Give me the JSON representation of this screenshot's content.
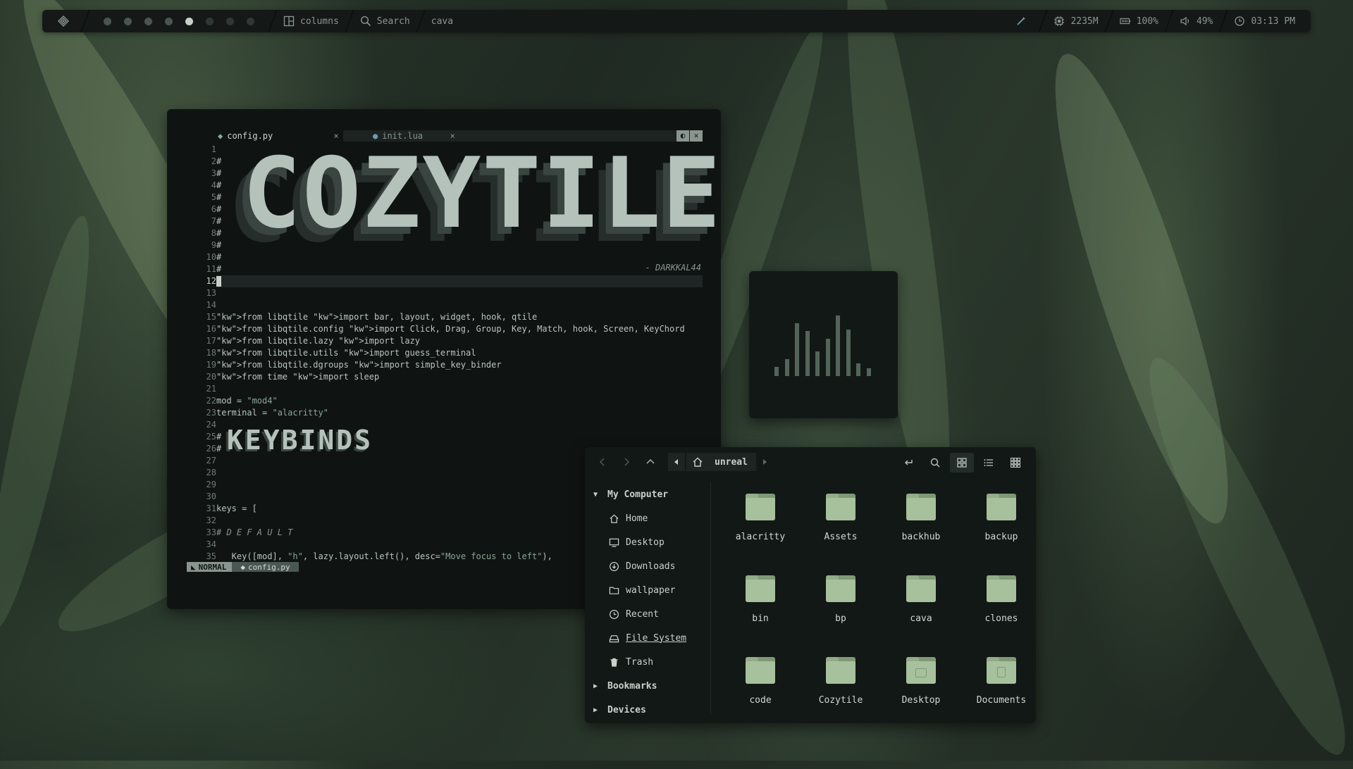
{
  "topbar": {
    "layout_label": "columns",
    "search_label": "Search",
    "window_title": "cava",
    "memory": "2235M",
    "battery": "100%",
    "volume": "49%",
    "clock": "03:13 PM",
    "workspaces": [
      "ws1",
      "ws2",
      "ws3",
      "ws4",
      "ws5",
      "ws6",
      "ws7",
      "ws8"
    ],
    "active_workspace": 5
  },
  "editor": {
    "tabs": [
      {
        "label": "config.py",
        "close": "×"
      },
      {
        "label": "init.lua",
        "close": "×"
      }
    ],
    "banner": "COZYTILE",
    "author": "- DARKKAL44",
    "section_banner": "KEYBINDS",
    "statusline": {
      "mode": "NORMAL",
      "file": "config.py"
    },
    "lines": [
      {
        "n": "1",
        "code": ""
      },
      {
        "n": "2",
        "code": "#"
      },
      {
        "n": "3",
        "code": "#"
      },
      {
        "n": "4",
        "code": "#"
      },
      {
        "n": "5",
        "code": "#"
      },
      {
        "n": "6",
        "code": "#"
      },
      {
        "n": "7",
        "code": "#"
      },
      {
        "n": "8",
        "code": "#"
      },
      {
        "n": "9",
        "code": "#"
      },
      {
        "n": "10",
        "code": "#"
      },
      {
        "n": "11",
        "code": "#"
      },
      {
        "n": "12",
        "code": ""
      },
      {
        "n": "13",
        "code": ""
      },
      {
        "n": "14",
        "code": ""
      },
      {
        "n": "15",
        "code": "from libqtile import bar, layout, widget, hook, qtile"
      },
      {
        "n": "16",
        "code": "from libqtile.config import Click, Drag, Group, Key, Match, hook, Screen, KeyChord"
      },
      {
        "n": "17",
        "code": "from libqtile.lazy import lazy"
      },
      {
        "n": "18",
        "code": "from libqtile.utils import guess_terminal"
      },
      {
        "n": "19",
        "code": "from libqtile.dgroups import simple_key_binder"
      },
      {
        "n": "20",
        "code": "from time import sleep"
      },
      {
        "n": "21",
        "code": ""
      },
      {
        "n": "22",
        "code": "mod = \"mod4\""
      },
      {
        "n": "23",
        "code": "terminal = \"alacritty\""
      },
      {
        "n": "24",
        "code": ""
      },
      {
        "n": "25",
        "code": "#"
      },
      {
        "n": "26",
        "code": "#"
      },
      {
        "n": "27",
        "code": ""
      },
      {
        "n": "28",
        "code": ""
      },
      {
        "n": "29",
        "code": ""
      },
      {
        "n": "30",
        "code": ""
      },
      {
        "n": "31",
        "code": "keys = ["
      },
      {
        "n": "32",
        "code": ""
      },
      {
        "n": "33",
        "code": "# D E F A U L T"
      },
      {
        "n": "34",
        "code": ""
      },
      {
        "n": "35",
        "code": "   Key([mod], \"h\", lazy.layout.left(), desc=\"Move focus to left\"),"
      }
    ]
  },
  "visualizer": {
    "levels": [
      0.12,
      0.22,
      0.68,
      0.58,
      0.32,
      0.48,
      0.78,
      0.6,
      0.16,
      0.1
    ]
  },
  "filemanager": {
    "location": "unreal",
    "sidebar": {
      "my_computer": "My Computer",
      "items": [
        {
          "label": "Home",
          "icon": "home-icon"
        },
        {
          "label": "Desktop",
          "icon": "monitor-icon"
        },
        {
          "label": "Downloads",
          "icon": "download-icon"
        },
        {
          "label": "wallpaper",
          "icon": "folder-icon"
        },
        {
          "label": "Recent",
          "icon": "clock-icon"
        },
        {
          "label": "File System",
          "icon": "drive-icon"
        },
        {
          "label": "Trash",
          "icon": "trash-icon"
        }
      ],
      "bookmarks": "Bookmarks",
      "devices": "Devices"
    },
    "files": [
      {
        "name": "alacritty",
        "kind": "folder"
      },
      {
        "name": "Assets",
        "kind": "folder"
      },
      {
        "name": "backhub",
        "kind": "folder"
      },
      {
        "name": "backup",
        "kind": "folder"
      },
      {
        "name": "bin",
        "kind": "folder"
      },
      {
        "name": "bp",
        "kind": "folder"
      },
      {
        "name": "cava",
        "kind": "folder"
      },
      {
        "name": "clones",
        "kind": "folder"
      },
      {
        "name": "code",
        "kind": "folder"
      },
      {
        "name": "Cozytile",
        "kind": "folder"
      },
      {
        "name": "Desktop",
        "kind": "desktop-folder"
      },
      {
        "name": "Documents",
        "kind": "documents-folder"
      }
    ]
  }
}
